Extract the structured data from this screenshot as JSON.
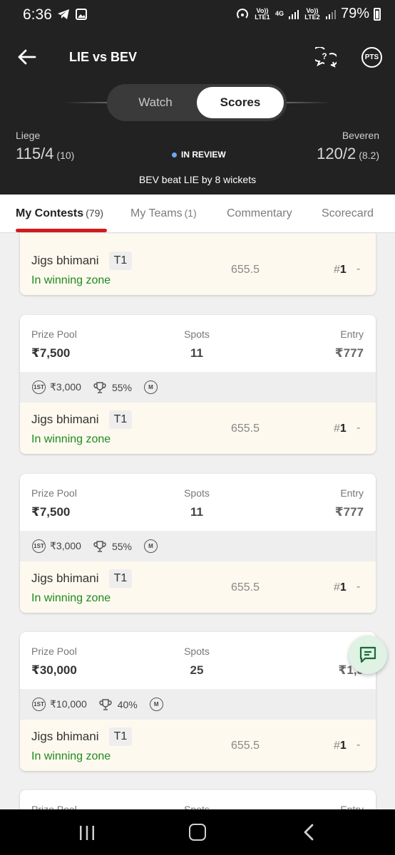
{
  "status_bar": {
    "time": "6:36",
    "net1": "Vo)) LTE1",
    "net2": "4G",
    "net3": "Vo)) LTE2",
    "battery": "79%"
  },
  "header": {
    "title": "LIE vs BEV",
    "pts_label": "PTS",
    "segment": {
      "watch": "Watch",
      "scores": "Scores",
      "selected": "Scores"
    }
  },
  "match": {
    "team_left": {
      "name": "Liege",
      "score": "115/4",
      "overs": "(10)"
    },
    "team_right": {
      "name": "Beveren",
      "score": "120/2",
      "overs": "(8.2)"
    },
    "status": "IN REVIEW",
    "result": "BEV beat LIE by 8 wickets"
  },
  "tabs": [
    {
      "label": "My Contests",
      "count": "(79)",
      "active": true
    },
    {
      "label": "My Teams",
      "count": "(1)",
      "active": false
    },
    {
      "label": "Commentary",
      "count": "",
      "active": false
    },
    {
      "label": "Scorecard",
      "count": "",
      "active": false
    }
  ],
  "labels": {
    "prize_pool": "Prize Pool",
    "spots": "Spots",
    "entry": "Entry"
  },
  "partial_top_row": {
    "team": "Jigs bhimani",
    "badge": "T1",
    "zone": "In winning zone",
    "points": "655.5",
    "rank_prefix": "#",
    "rank": "1",
    "dash": "-"
  },
  "contests": [
    {
      "prize_pool": "₹7,500",
      "spots": "11",
      "entry": "₹777",
      "first_prize": "₹3,000",
      "win_pct": "55%",
      "badge_first": "1ST",
      "badge_m": "M",
      "team": "Jigs bhimani",
      "team_badge": "T1",
      "zone": "In winning zone",
      "points": "655.5",
      "rank_prefix": "#",
      "rank": "1",
      "dash": "-"
    },
    {
      "prize_pool": "₹7,500",
      "spots": "11",
      "entry": "₹777",
      "first_prize": "₹3,000",
      "win_pct": "55%",
      "badge_first": "1ST",
      "badge_m": "M",
      "team": "Jigs bhimani",
      "team_badge": "T1",
      "zone": "In winning zone",
      "points": "655.5",
      "rank_prefix": "#",
      "rank": "1",
      "dash": "-"
    },
    {
      "prize_pool": "₹30,000",
      "spots": "25",
      "entry": "₹1,3",
      "entry_label": "E",
      "first_prize": "₹10,000",
      "win_pct": "40%",
      "badge_first": "1ST",
      "badge_m": "M",
      "team": "Jigs bhimani",
      "team_badge": "T1",
      "zone": "In winning zone",
      "points": "655.5",
      "rank_prefix": "#",
      "rank": "1",
      "dash": "-"
    },
    {
      "prize_pool_label": "Prize Pool",
      "spots_label": "Spots",
      "entry_label": "Entry"
    }
  ],
  "colors": {
    "header_bg": "#222222",
    "accent_red": "#d11b1b",
    "winning_green": "#1f8a1f",
    "review_dot": "#6aa8f5",
    "team_row_bg": "#fdf9ee"
  },
  "icons": [
    "back-arrow-icon",
    "help-chat-icon",
    "pts-icon",
    "first-prize-icon",
    "trophy-icon",
    "m-badge-icon",
    "chat-icon",
    "nav-recent-icon",
    "nav-home-icon",
    "nav-back-icon"
  ]
}
